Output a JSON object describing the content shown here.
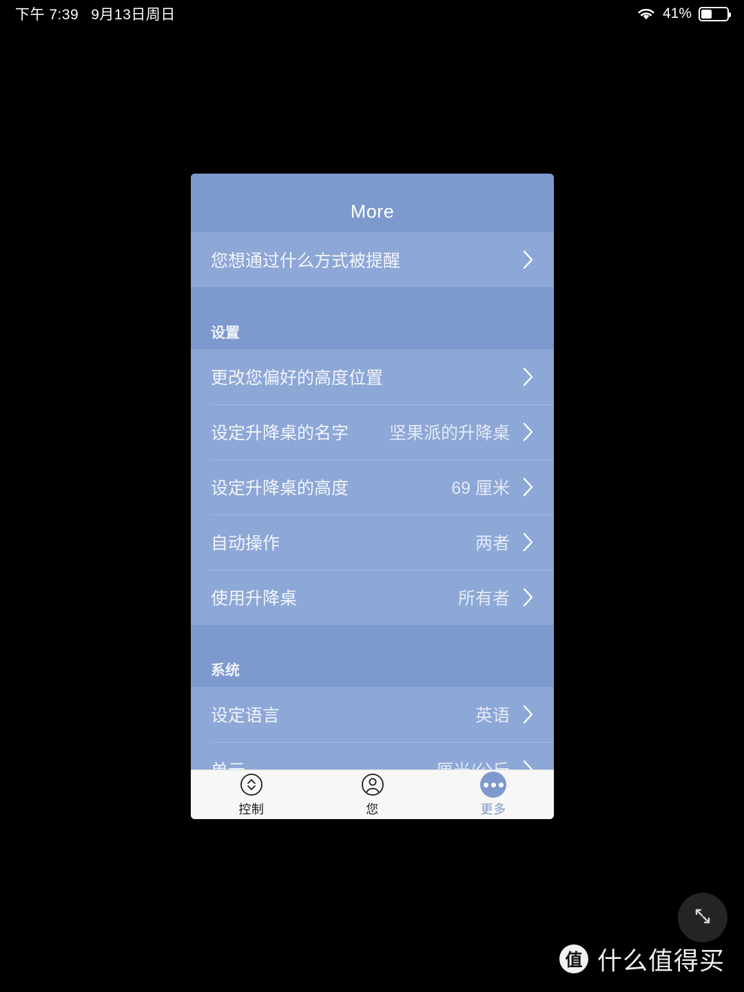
{
  "status_bar": {
    "time": "下午 7:39",
    "date": "9月13日周日",
    "battery_percent": "41%",
    "battery_level": 41,
    "wifi_icon": "wifi-icon",
    "battery_icon": "battery-icon"
  },
  "app": {
    "header_title": "More",
    "accent_color": "#7d99cd",
    "row_color": "#8da7d6",
    "top_row": {
      "label": "您想通过什么方式被提醒",
      "value": "",
      "chevron": "chevron-right-icon"
    },
    "sections": [
      {
        "heading": "设置",
        "rows": [
          {
            "label": "更改您偏好的高度位置",
            "value": ""
          },
          {
            "label": "设定升降桌的名字",
            "value": "坚果派的升降桌"
          },
          {
            "label": "设定升降桌的高度",
            "value": "69 厘米"
          },
          {
            "label": "自动操作",
            "value": "两者"
          },
          {
            "label": "使用升降桌",
            "value": "所有者"
          }
        ]
      },
      {
        "heading": "系统",
        "rows": [
          {
            "label": "设定语言",
            "value": "英语"
          },
          {
            "label": "单元",
            "value": "厘米/公斤"
          }
        ]
      }
    ],
    "tabs": [
      {
        "label": "控制",
        "icon": "up-down-arrows-circle-icon",
        "active": false
      },
      {
        "label": "您",
        "icon": "person-circle-icon",
        "active": false
      },
      {
        "label": "更多",
        "icon": "more-dots-circle-icon",
        "active": true
      }
    ]
  },
  "overlay": {
    "watermark_badge": "值",
    "watermark_text": "什么值得买",
    "expand_icon": "expand-fullscreen-icon"
  }
}
